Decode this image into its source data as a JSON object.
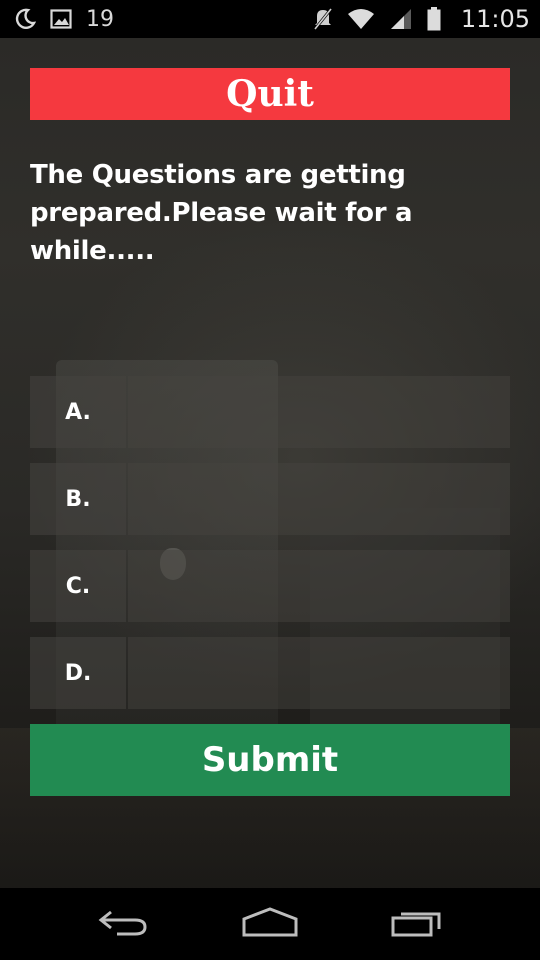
{
  "status_bar": {
    "notification_count": "19",
    "time": "11:05",
    "icons": [
      "moon-icon",
      "image-icon",
      "mute-icon",
      "wifi-icon",
      "signal-icon",
      "battery-icon"
    ]
  },
  "quiz": {
    "quit_label": "Quit",
    "question": "The Questions are getting prepared.Please wait for a while.....",
    "options": [
      {
        "letter": "A.",
        "text": ""
      },
      {
        "letter": "B.",
        "text": ""
      },
      {
        "letter": "C.",
        "text": ""
      },
      {
        "letter": "D.",
        "text": ""
      }
    ],
    "submit_label": "Submit"
  },
  "colors": {
    "quit": "#f5393f",
    "submit": "#228b52"
  },
  "nav_bar": {
    "icons": [
      "back-icon",
      "home-icon",
      "recents-icon"
    ]
  }
}
